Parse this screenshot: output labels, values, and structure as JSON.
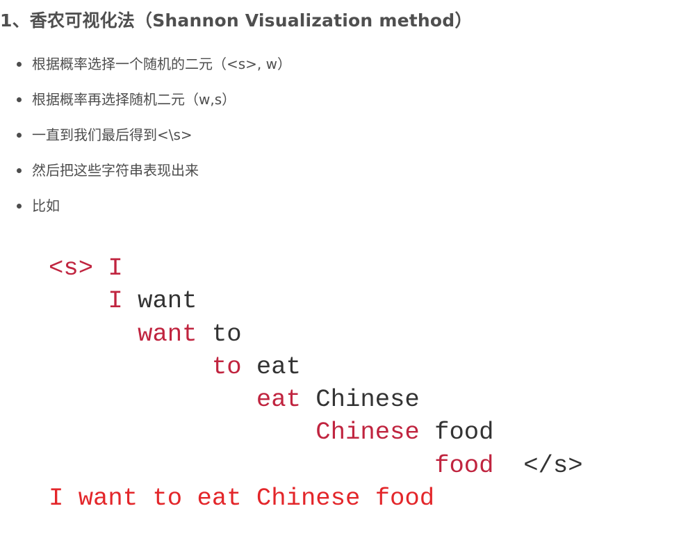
{
  "heading": "1、香农可视化法（Shannon Visualization method）",
  "bullets": [
    "根据概率选择一个随机的二元（<s>, w）",
    "根据概率再选择随机二元（w,s）",
    "一直到我们最后得到<\\s>",
    "然后把这些字符串表现出来",
    "比如"
  ],
  "example": {
    "rows": [
      [
        {
          "text": "<s>",
          "role": "red"
        },
        {
          "text": "I",
          "role": "red"
        }
      ],
      [
        {
          "text": "I",
          "role": "red"
        },
        {
          "text": "want",
          "role": "black"
        }
      ],
      [
        {
          "text": "want",
          "role": "red"
        },
        {
          "text": "to",
          "role": "black"
        }
      ],
      [
        {
          "text": "to",
          "role": "red"
        },
        {
          "text": "eat",
          "role": "black"
        }
      ],
      [
        {
          "text": "eat",
          "role": "red"
        },
        {
          "text": "Chinese",
          "role": "black"
        }
      ],
      [
        {
          "text": "Chinese",
          "role": "red"
        },
        {
          "text": "food",
          "role": "black"
        }
      ],
      [
        {
          "text": "food",
          "role": "red"
        },
        {
          "text": "</s>",
          "role": "black"
        }
      ]
    ],
    "result": "I want to eat Chinese food"
  },
  "colors": {
    "token_red": "#c0243f",
    "token_black": "#333333",
    "result_red": "#e3262a"
  }
}
